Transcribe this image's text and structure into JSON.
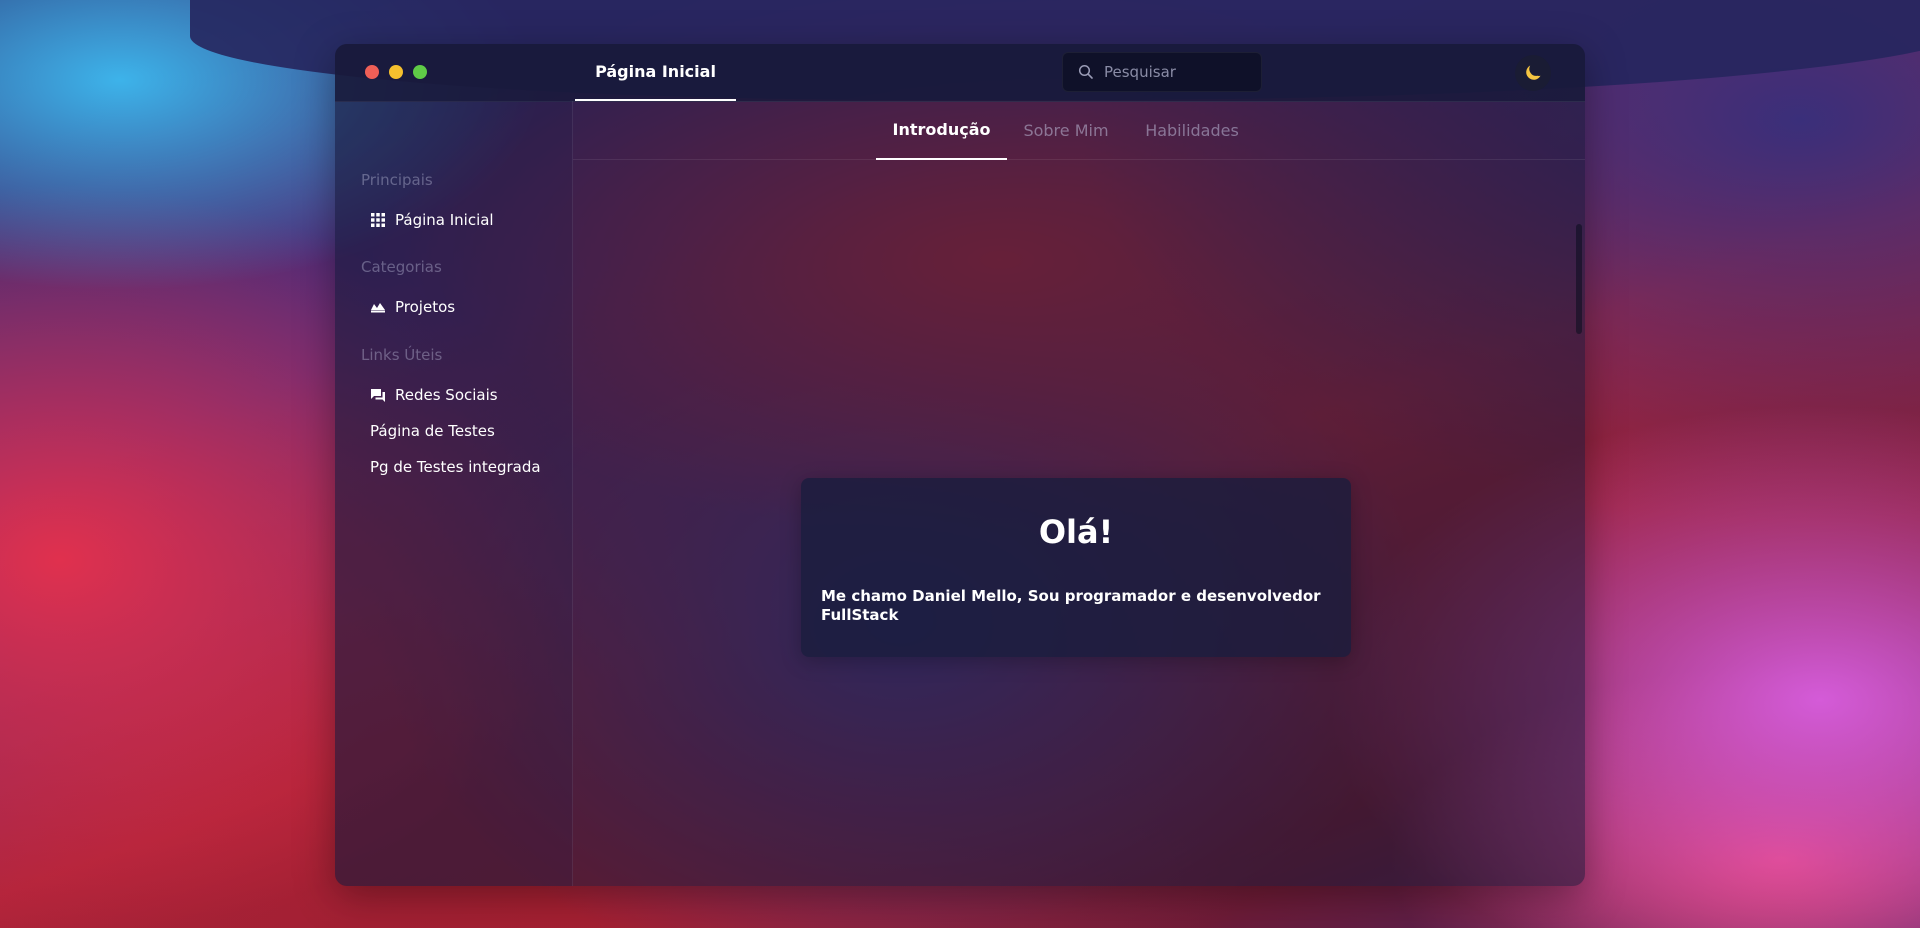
{
  "window": {
    "tab_title": "Página Inicial"
  },
  "search": {
    "placeholder": "Pesquisar"
  },
  "theme_toggle": {
    "icon": "moon-icon",
    "icon_color": "#f5c542"
  },
  "sidebar": {
    "sections": [
      {
        "title": "Principais"
      },
      {
        "title": "Categorias"
      },
      {
        "title": "Links Úteis"
      }
    ],
    "items": [
      {
        "label": "Página Inicial",
        "icon": "grid-icon"
      },
      {
        "label": "Projetos",
        "icon": "projects-icon"
      },
      {
        "label": "Redes Sociais",
        "icon": "chat-icon"
      },
      {
        "label": "Página de Testes"
      },
      {
        "label": "Pg de Testes integrada"
      }
    ]
  },
  "content": {
    "tabs": [
      {
        "label": "Introdução",
        "active": true
      },
      {
        "label": "Sobre Mim",
        "active": false
      },
      {
        "label": "Habilidades",
        "active": false
      }
    ],
    "card": {
      "title": "Olá!",
      "text": "Me chamo Daniel Mello, Sou programador e desenvolvedor FullStack"
    }
  },
  "colors": {
    "close": "#ee5f57",
    "minimize": "#f5c02e",
    "maximize": "#5fcb47"
  }
}
